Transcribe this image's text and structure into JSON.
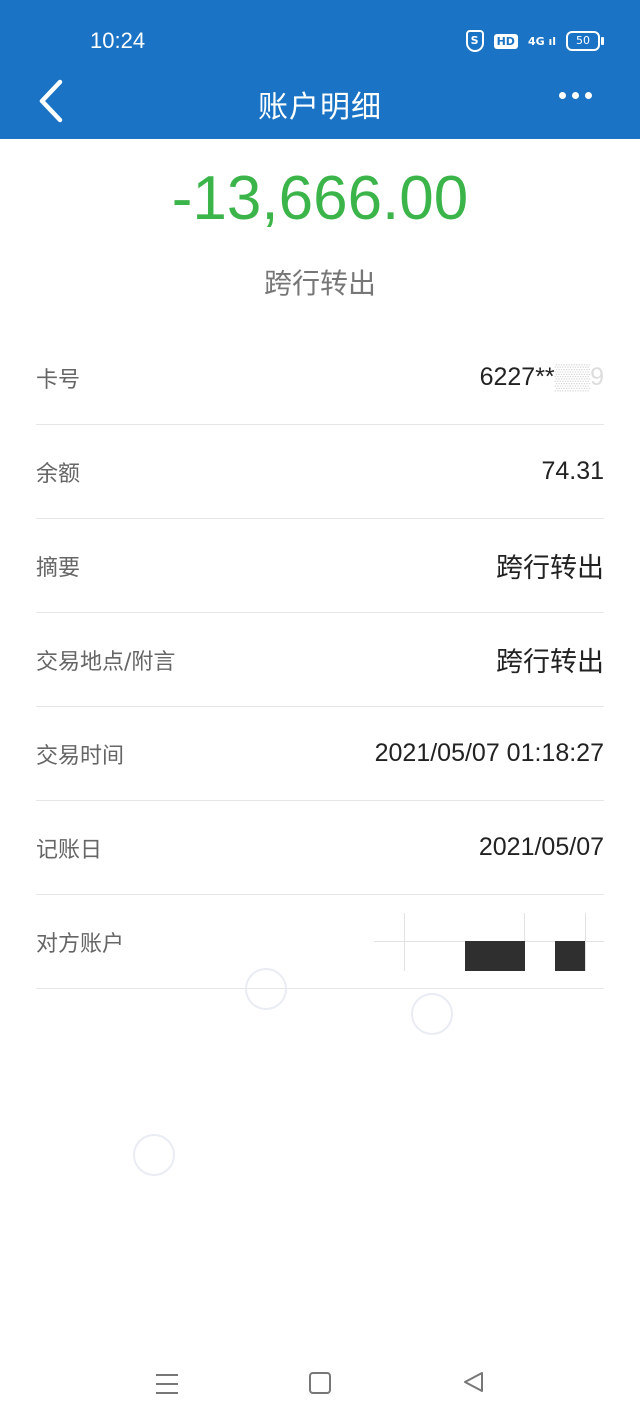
{
  "status_bar": {
    "time": "10:24",
    "shield_glyph": "S",
    "hd": "HD",
    "network": "4G",
    "battery": "50"
  },
  "header": {
    "title": "账户明细",
    "back_icon": "chevron-left-icon",
    "more_icon": "more-horizontal-icon"
  },
  "summary": {
    "amount": "-13,666.00",
    "amount_color": "#3bb54a",
    "type": "跨行转出"
  },
  "details": {
    "card_label": "卡号",
    "card_value": "6227**",
    "card_tail": "9",
    "balance_label": "余额",
    "balance_value": "74.31",
    "summary_label": "摘要",
    "summary_value": "跨行转出",
    "location_label": "交易地点/附言",
    "location_value": "跨行转出",
    "time_label": "交易时间",
    "time_value": "2021/05/07 01:18:27",
    "posting_label": "记账日",
    "posting_value": "2021/05/07",
    "counterparty_label": "对方账户"
  },
  "colors": {
    "header_bg": "#1a73c4",
    "accent_green": "#3bb54a"
  }
}
